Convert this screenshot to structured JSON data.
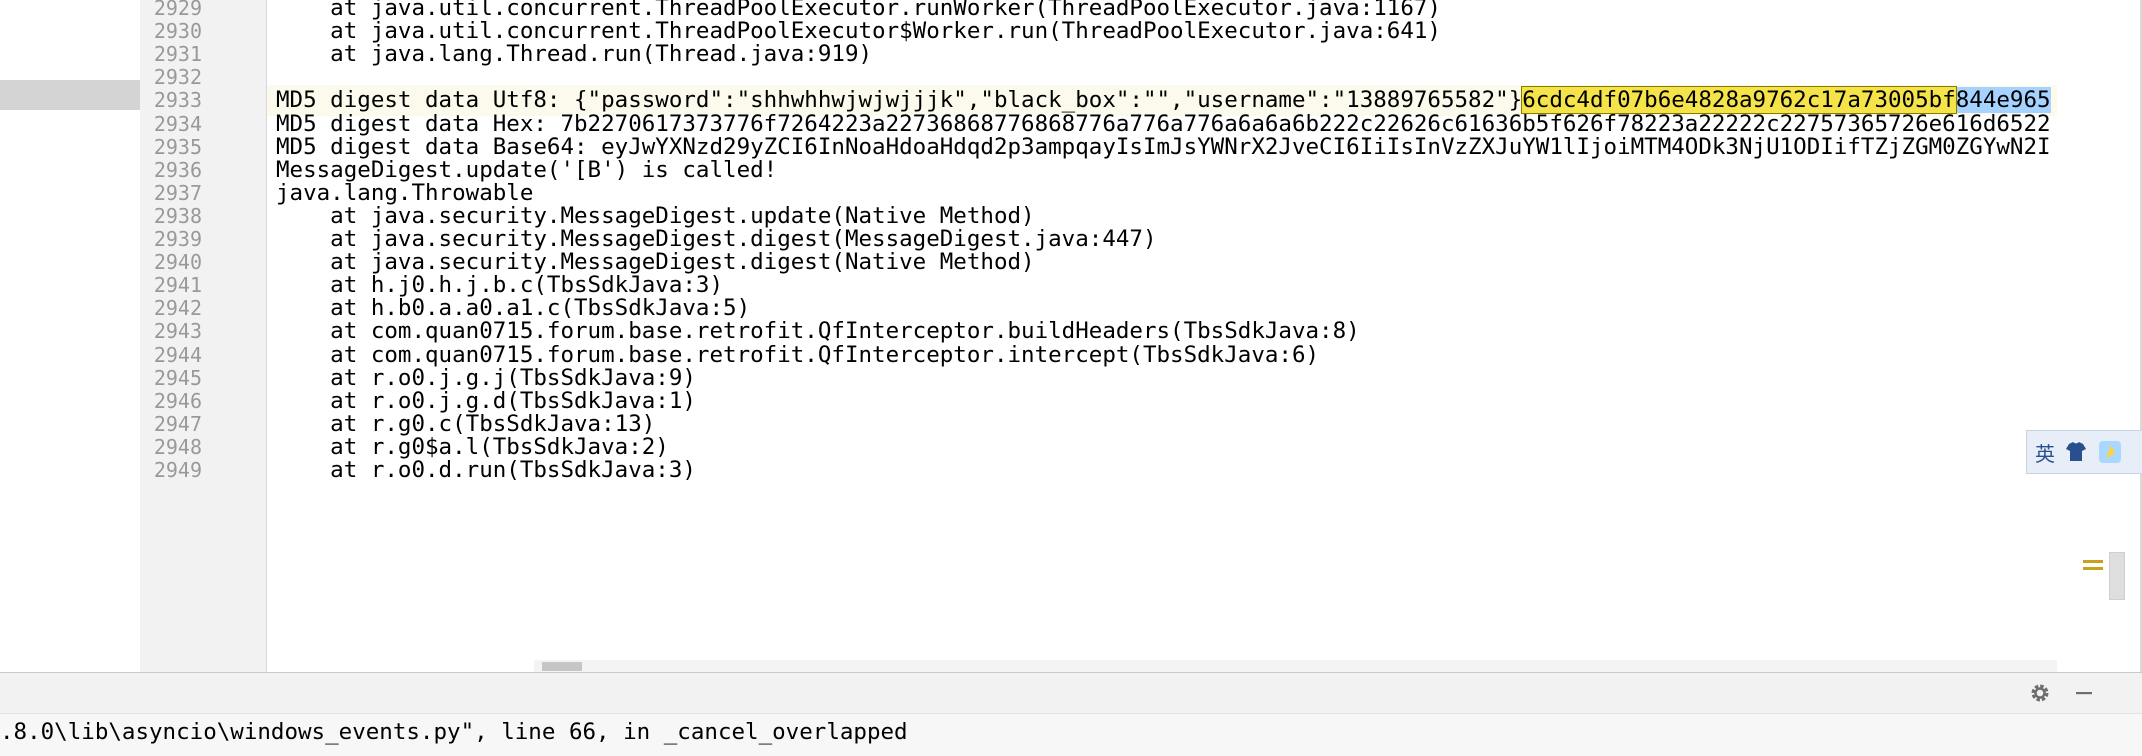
{
  "editor": {
    "lines": [
      {
        "num": "2929",
        "text": "    at java.util.concurrent.ThreadPoolExecutor.runWorker(ThreadPoolExecutor.java:1167)"
      },
      {
        "num": "2930",
        "text": "    at java.util.concurrent.ThreadPoolExecutor$Worker.run(ThreadPoolExecutor.java:641)"
      },
      {
        "num": "2931",
        "text": "    at java.lang.Thread.run(Thread.java:919)"
      },
      {
        "num": "2932",
        "text": ""
      },
      {
        "num": "2933",
        "text": "MD5 digest data Utf8: {\"password\":\"shhwhhwjwjwjjjk\",\"black_box\":\"\",\"username\":\"13889765582\"}",
        "highlight": "6cdc4df07b6e4828a9762c17a73005bf",
        "highlight2": "844e965"
      },
      {
        "num": "2934",
        "text": "MD5 digest data Hex: 7b2270617373776f7264223a22736868776868776a776a776a6a6a6b222c22626c61636b5f626f78223a22222c22757365726e616d6522"
      },
      {
        "num": "2935",
        "text": "MD5 digest data Base64: eyJwYXNzd29yZCI6InNoaHdoaHdqd2p3ampqayIsImJsYWNrX2JveCI6IiIsInVzZXJuYW1lIjoiMTM4ODk3NjU1ODIifTZjZGM0ZGYwN2I"
      },
      {
        "num": "2936",
        "text": "MessageDigest.update('[B') is called!"
      },
      {
        "num": "2937",
        "text": "java.lang.Throwable"
      },
      {
        "num": "2938",
        "text": "    at java.security.MessageDigest.update(Native Method)"
      },
      {
        "num": "2939",
        "text": "    at java.security.MessageDigest.digest(MessageDigest.java:447)"
      },
      {
        "num": "2940",
        "text": "    at java.security.MessageDigest.digest(Native Method)"
      },
      {
        "num": "2941",
        "text": "    at h.j0.h.j.b.c(TbsSdkJava:3)"
      },
      {
        "num": "2942",
        "text": "    at h.b0.a.a0.a1.c(TbsSdkJava:5)"
      },
      {
        "num": "2943",
        "text": "    at com.quan0715.forum.base.retrofit.QfInterceptor.buildHeaders(TbsSdkJava:8)"
      },
      {
        "num": "2944",
        "text": "    at com.quan0715.forum.base.retrofit.QfInterceptor.intercept(TbsSdkJava:6)"
      },
      {
        "num": "2945",
        "text": "    at r.o0.j.g.j(TbsSdkJava:9)"
      },
      {
        "num": "2946",
        "text": "    at r.o0.j.g.d(TbsSdkJava:1)"
      },
      {
        "num": "2947",
        "text": "    at r.g0.c(TbsSdkJava:13)"
      },
      {
        "num": "2948",
        "text": "    at r.g0$a.l(TbsSdkJava:2)"
      },
      {
        "num": "2949",
        "text": "    at r.o0.d.run(TbsSdkJava:3)"
      }
    ],
    "current_line": "2933"
  },
  "ime_indicator": {
    "label": "英"
  },
  "console": {
    "line": ".8.0\\lib\\asyncio\\windows_events.py\", line 66, in _cancel_overlapped"
  },
  "icons": {
    "settings": "gear-icon",
    "hide": "minimize-icon",
    "ime_shirt": "shirt-icon",
    "ime_skin": "skin-icon"
  },
  "colors": {
    "highlight": "#f5e34a",
    "selection": "#a6d2ff",
    "current_line": "#fcfaed",
    "line_numbers": "#999999"
  }
}
